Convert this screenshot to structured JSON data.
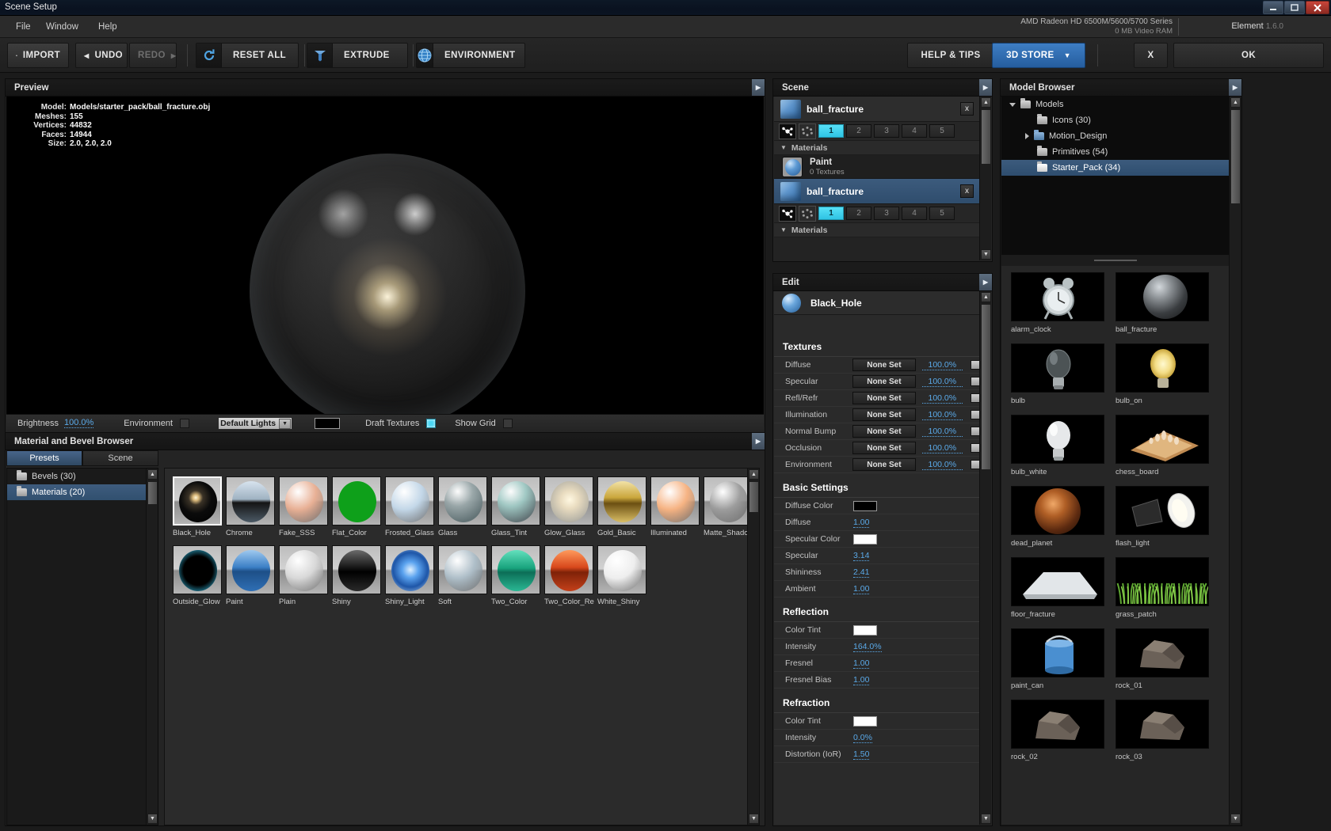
{
  "window": {
    "title": "Scene Setup",
    "minimize": "—",
    "maximize": "❐",
    "close": "✕"
  },
  "menu": {
    "items": [
      "File",
      "Window",
      "Help"
    ],
    "gpu_name": "AMD Radeon HD 6500M/5600/5700 Series",
    "gpu_ram": "0 MB Video RAM",
    "product": "Element",
    "version": "1.6.0"
  },
  "toolbar": {
    "import": "IMPORT",
    "undo": "UNDO",
    "redo": "REDO",
    "reset_all": "RESET ALL",
    "extrude": "EXTRUDE",
    "environment": "ENVIRONMENT",
    "help_tips": "HELP & TIPS",
    "store": "3D STORE",
    "cancel": "X",
    "ok": "OK"
  },
  "preview": {
    "title": "Preview",
    "info": [
      {
        "key": "Model:",
        "value": "Models/starter_pack/ball_fracture.obj"
      },
      {
        "key": "Meshes:",
        "value": "155"
      },
      {
        "key": "Vertices:",
        "value": "44832"
      },
      {
        "key": "Faces:",
        "value": "14944"
      },
      {
        "key": "Size:",
        "value": "2.0, 2.0, 2.0"
      }
    ],
    "footer": {
      "brightness_label": "Brightness",
      "brightness_value": "100.0%",
      "environment_label": "Environment",
      "lights_preset": "Default Lights",
      "draft_textures_label": "Draft Textures",
      "show_grid_label": "Show Grid"
    }
  },
  "material_browser": {
    "title": "Material and Bevel Browser",
    "tabs": [
      "Presets",
      "Scene"
    ],
    "active_tab": "Presets",
    "tree": [
      {
        "label": "Bevels (30)",
        "selected": false
      },
      {
        "label": "Materials (20)",
        "selected": true
      }
    ],
    "swatches": [
      {
        "label": "Black_Hole",
        "selected": true,
        "color": "#0a0a0a",
        "style": "glow"
      },
      {
        "label": "Chrome",
        "selected": false,
        "color": "#8f9aa3",
        "style": "chrome"
      },
      {
        "label": "Fake_SSS",
        "selected": false,
        "color": "#e8b095",
        "style": "solid"
      },
      {
        "label": "Flat_Color",
        "selected": false,
        "color": "#0ea01a",
        "style": "flat"
      },
      {
        "label": "Frosted_Glass",
        "selected": false,
        "color": "#c3d7e8",
        "style": "solid"
      },
      {
        "label": "Glass",
        "selected": false,
        "color": "#98a6a8",
        "style": "glass"
      },
      {
        "label": "Glass_Tint",
        "selected": false,
        "color": "#9fc9c4",
        "style": "glass"
      },
      {
        "label": "Glow_Glass",
        "selected": false,
        "color": "#e6e0cf",
        "style": "glow2"
      },
      {
        "label": "Gold_Basic",
        "selected": false,
        "color": "#b8932f",
        "style": "gold"
      },
      {
        "label": "Illuminated",
        "selected": false,
        "color": "#f6b383",
        "style": "solid"
      },
      {
        "label": "Matte_Shadow",
        "selected": false,
        "color": "#9d9d9d",
        "style": "solid"
      },
      {
        "label": "Outside_Glow",
        "selected": false,
        "color": "#040404",
        "style": "outglow"
      },
      {
        "label": "Paint",
        "selected": false,
        "color": "#2f6fb5",
        "style": "paint"
      },
      {
        "label": "Plain",
        "selected": false,
        "color": "#d8d8d8",
        "style": "solid"
      },
      {
        "label": "Shiny",
        "selected": false,
        "color": "#141414",
        "style": "shiny"
      },
      {
        "label": "Shiny_Light",
        "selected": false,
        "color": "#3f7ddd",
        "style": "shinylight"
      },
      {
        "label": "Soft",
        "selected": false,
        "color": "#aebec8",
        "style": "solid"
      },
      {
        "label": "Two_Color",
        "selected": false,
        "color": "#1f9d7c",
        "style": "two"
      },
      {
        "label": "Two_Color_Re",
        "selected": false,
        "color": "#c0361a",
        "style": "twored"
      },
      {
        "label": "White_Shiny",
        "selected": false,
        "color": "#eeeeee",
        "style": "solid"
      }
    ]
  },
  "scene": {
    "title": "Scene",
    "objects": [
      {
        "name": "ball_fracture",
        "selected": false,
        "close_label": "x",
        "groups": [
          "1",
          "2",
          "3",
          "4",
          "5"
        ],
        "active_group": "1",
        "materials_label": "Materials",
        "materials": [
          {
            "name": "Paint",
            "textures": "0 Textures"
          }
        ]
      },
      {
        "name": "ball_fracture",
        "selected": true,
        "close_label": "x",
        "groups": [
          "1",
          "2",
          "3",
          "4",
          "5"
        ],
        "active_group": "1",
        "materials_label": "Materials",
        "materials": []
      }
    ]
  },
  "edit": {
    "title": "Edit",
    "material_name": "Black_Hole",
    "sections": [
      {
        "title": "Textures",
        "rows": [
          {
            "label": "Diffuse",
            "button": "None Set",
            "percent": "100.0%",
            "has_box": true
          },
          {
            "label": "Specular",
            "button": "None Set",
            "percent": "100.0%",
            "has_box": true
          },
          {
            "label": "Refl/Refr",
            "button": "None Set",
            "percent": "100.0%",
            "has_box": true
          },
          {
            "label": "Illumination",
            "button": "None Set",
            "percent": "100.0%",
            "has_box": true
          },
          {
            "label": "Normal Bump",
            "button": "None Set",
            "percent": "100.0%",
            "has_box": true
          },
          {
            "label": "Occlusion",
            "button": "None Set",
            "percent": "100.0%",
            "has_box": true
          },
          {
            "label": "Environment",
            "button": "None Set",
            "percent": "100.0%",
            "has_box": true
          }
        ]
      },
      {
        "title": "Basic Settings",
        "rows": [
          {
            "label": "Diffuse Color",
            "color": "#000000"
          },
          {
            "label": "Diffuse",
            "value": "1.00"
          },
          {
            "label": "Specular Color",
            "color": "#ffffff"
          },
          {
            "label": "Specular",
            "value": "3.14"
          },
          {
            "label": "Shininess",
            "value": "2.41"
          },
          {
            "label": "Ambient",
            "value": "1.00"
          }
        ]
      },
      {
        "title": "Reflection",
        "rows": [
          {
            "label": "Color Tint",
            "color": "#ffffff"
          },
          {
            "label": "Intensity",
            "value": "164.0%"
          },
          {
            "label": "Fresnel",
            "value": "1.00"
          },
          {
            "label": "Fresnel Bias",
            "value": "1.00"
          }
        ]
      },
      {
        "title": "Refraction",
        "rows": [
          {
            "label": "Color Tint",
            "color": "#ffffff"
          },
          {
            "label": "Intensity",
            "value": "0.0%"
          },
          {
            "label": "Distortion (IoR)",
            "value": "1.50"
          }
        ]
      }
    ]
  },
  "model_browser": {
    "title": "Model Browser",
    "tree": [
      {
        "label": "Models",
        "depth": 0,
        "arrow": "down",
        "selected": false,
        "folder": "grey"
      },
      {
        "label": "Icons (30)",
        "depth": 1,
        "arrow": "none",
        "selected": false,
        "folder": "grey"
      },
      {
        "label": "Motion_Design",
        "depth": 1,
        "arrow": "right",
        "selected": false,
        "folder": "blue"
      },
      {
        "label": "Primitives (54)",
        "depth": 1,
        "arrow": "none",
        "selected": false,
        "folder": "grey"
      },
      {
        "label": "Starter_Pack (34)",
        "depth": 1,
        "arrow": "none",
        "selected": true,
        "folder": "white"
      }
    ],
    "models": [
      {
        "label": "alarm_clock",
        "kind": "clock"
      },
      {
        "label": "ball_fracture",
        "kind": "ball"
      },
      {
        "label": "bulb",
        "kind": "bulb_dark"
      },
      {
        "label": "bulb_on",
        "kind": "bulb_on"
      },
      {
        "label": "bulb_white",
        "kind": "bulb_white"
      },
      {
        "label": "chess_board",
        "kind": "chess"
      },
      {
        "label": "dead_planet",
        "kind": "planet"
      },
      {
        "label": "flash_light",
        "kind": "flash"
      },
      {
        "label": "floor_fracture",
        "kind": "floor"
      },
      {
        "label": "grass_patch",
        "kind": "grass"
      },
      {
        "label": "paint_can",
        "kind": "paintcan"
      },
      {
        "label": "rock_01",
        "kind": "rock"
      },
      {
        "label": "rock_02",
        "kind": "rock"
      },
      {
        "label": "rock_03",
        "kind": "rock"
      }
    ]
  },
  "icons": {
    "folder": "folder-icon",
    "undo_arrow": "◀",
    "redo_arrow": "▶",
    "chevron_down": "▼",
    "chevron_right": "▶",
    "chevron_up": "▲",
    "collapse": "▶"
  }
}
